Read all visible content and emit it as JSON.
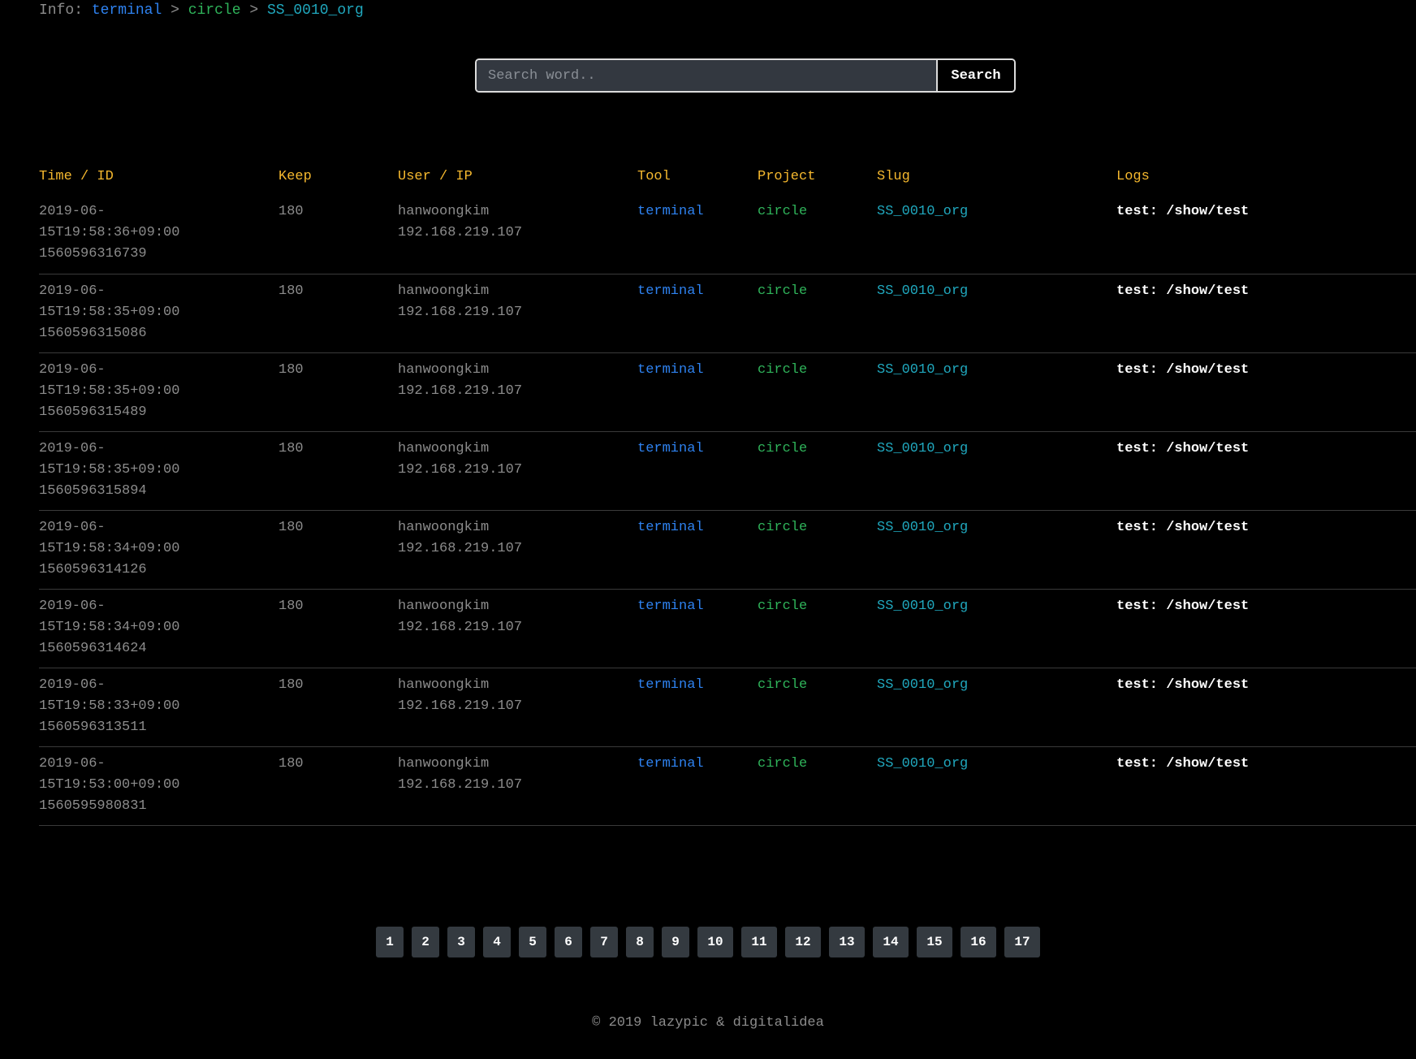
{
  "breadcrumb": {
    "prefix": "Info:",
    "tool": "terminal",
    "project": "circle",
    "slug": "SS_0010_org",
    "separator": ">"
  },
  "search": {
    "placeholder": "Search word..",
    "value": "",
    "button_label": "Search"
  },
  "table": {
    "headers": [
      "Time / ID",
      "Keep",
      "User / IP",
      "Tool",
      "Project",
      "Slug",
      "Logs"
    ],
    "rows": [
      {
        "time": "2019-06-15T19:58:36+09:00",
        "id": "1560596316739",
        "keep": "180",
        "user": "hanwoongkim",
        "ip": "192.168.219.107",
        "tool": "terminal",
        "project": "circle",
        "slug": "SS_0010_org",
        "log": "test: /show/test"
      },
      {
        "time": "2019-06-15T19:58:35+09:00",
        "id": "1560596315086",
        "keep": "180",
        "user": "hanwoongkim",
        "ip": "192.168.219.107",
        "tool": "terminal",
        "project": "circle",
        "slug": "SS_0010_org",
        "log": "test: /show/test"
      },
      {
        "time": "2019-06-15T19:58:35+09:00",
        "id": "1560596315489",
        "keep": "180",
        "user": "hanwoongkim",
        "ip": "192.168.219.107",
        "tool": "terminal",
        "project": "circle",
        "slug": "SS_0010_org",
        "log": "test: /show/test"
      },
      {
        "time": "2019-06-15T19:58:35+09:00",
        "id": "1560596315894",
        "keep": "180",
        "user": "hanwoongkim",
        "ip": "192.168.219.107",
        "tool": "terminal",
        "project": "circle",
        "slug": "SS_0010_org",
        "log": "test: /show/test"
      },
      {
        "time": "2019-06-15T19:58:34+09:00",
        "id": "1560596314126",
        "keep": "180",
        "user": "hanwoongkim",
        "ip": "192.168.219.107",
        "tool": "terminal",
        "project": "circle",
        "slug": "SS_0010_org",
        "log": "test: /show/test"
      },
      {
        "time": "2019-06-15T19:58:34+09:00",
        "id": "1560596314624",
        "keep": "180",
        "user": "hanwoongkim",
        "ip": "192.168.219.107",
        "tool": "terminal",
        "project": "circle",
        "slug": "SS_0010_org",
        "log": "test: /show/test"
      },
      {
        "time": "2019-06-15T19:58:33+09:00",
        "id": "1560596313511",
        "keep": "180",
        "user": "hanwoongkim",
        "ip": "192.168.219.107",
        "tool": "terminal",
        "project": "circle",
        "slug": "SS_0010_org",
        "log": "test: /show/test"
      },
      {
        "time": "2019-06-15T19:53:00+09:00",
        "id": "1560595980831",
        "keep": "180",
        "user": "hanwoongkim",
        "ip": "192.168.219.107",
        "tool": "terminal",
        "project": "circle",
        "slug": "SS_0010_org",
        "log": "test: /show/test"
      }
    ]
  },
  "pagination": {
    "pages": [
      "1",
      "2",
      "3",
      "4",
      "5",
      "6",
      "7",
      "8",
      "9",
      "10",
      "11",
      "12",
      "13",
      "14",
      "15",
      "16",
      "17"
    ]
  },
  "footer": {
    "text": "© 2019 lazypic & digitalidea"
  },
  "colors": {
    "background": "#000000",
    "header": "#f5b82e",
    "tool": "#2e82f0",
    "project": "#2fb35a",
    "slug": "#20a8be",
    "muted": "#8c8c8c",
    "page_button": "#343a40"
  }
}
